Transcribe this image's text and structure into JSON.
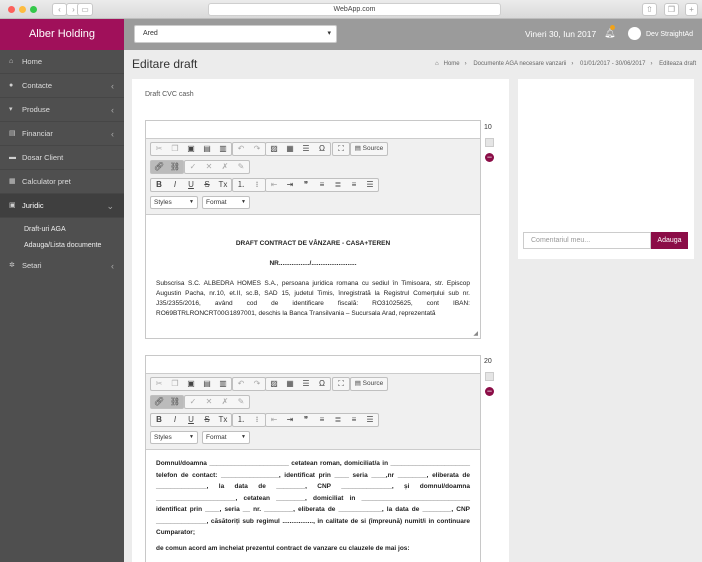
{
  "browser": {
    "url": "WebApp.com"
  },
  "app": {
    "brand": "Alber Holding"
  },
  "sidebar": {
    "items": [
      {
        "label": "Home",
        "icon": "home-icon"
      },
      {
        "label": "Contacte",
        "icon": "user-icon"
      },
      {
        "label": "Produse",
        "icon": "cart-icon"
      },
      {
        "label": "Financiar",
        "icon": "chart-icon"
      },
      {
        "label": "Dosar Client",
        "icon": "folder-icon"
      },
      {
        "label": "Calculator pret",
        "icon": "calculator-icon"
      },
      {
        "label": "Juridic",
        "icon": "briefcase-icon"
      }
    ],
    "subitems": [
      "Draft-uri AGA",
      "Adauga/Lista documente"
    ],
    "setari": {
      "label": "Setari",
      "icon": "gears-icon"
    }
  },
  "topbar": {
    "select_value": "Ared",
    "date": "Vineri 30, Iun 2017",
    "user": "Dev StraightAd"
  },
  "page": {
    "title": "Editare draft",
    "breadcrumb": [
      "Home",
      "Documente AGA necesare vanzarii",
      "01/01/2017 - 30/06/2017",
      "Editeaza draft"
    ],
    "draft_name": "Draft CVC cash"
  },
  "toolbar": {
    "source": "Source",
    "styles": "Styles",
    "format": "Format"
  },
  "editors": [
    {
      "order": "10",
      "title": "DRAFT CONTRACT DE VÂNZARE - CASA+TEREN",
      "nr": "NR................./.........................",
      "body": "Subscrisa S.C. ALBEDRA HOMES S.A., persoana juridica romana cu sediul în  Timisoara, str. Episcop Augustin Pacha, nr.10, et.II, sc.B, SAD 15, judetul Timis, înregistrată la Registrul Comerțului sub nr. J35/2355/2016, având cod de identificare fiscală: RO31025625, cont IBAN: RO69BTRLRONCRT00G1897001, deschis la Banca Transilvania – Sucursala Arad, reprezentată"
    },
    {
      "order": "20",
      "body": "Domnul/doamna ______________________ cetatean roman, domiciliat/a in ______________________ telefon de contact: ________________, identificat prin ____ seria ____,nr ________, eliberata de ______________, la data de ________, CNP ______________, și domnul/doamna ______________________, cetatean ________, domiciliat in ______________________________ identificat prin ____, seria __ nr. ________, eliberata de ____________, la data de ________, CNP ______________, căsătoriți sub regimul ................., in calitate de si (împreună) numit/i in continuare Cumparator;",
      "footer": "de comun acord am incheiat prezentul contract de vanzare cu clauzele de mai jos:"
    }
  ],
  "comments": {
    "placeholder": "Comentariul meu...",
    "button": "Adauga"
  }
}
